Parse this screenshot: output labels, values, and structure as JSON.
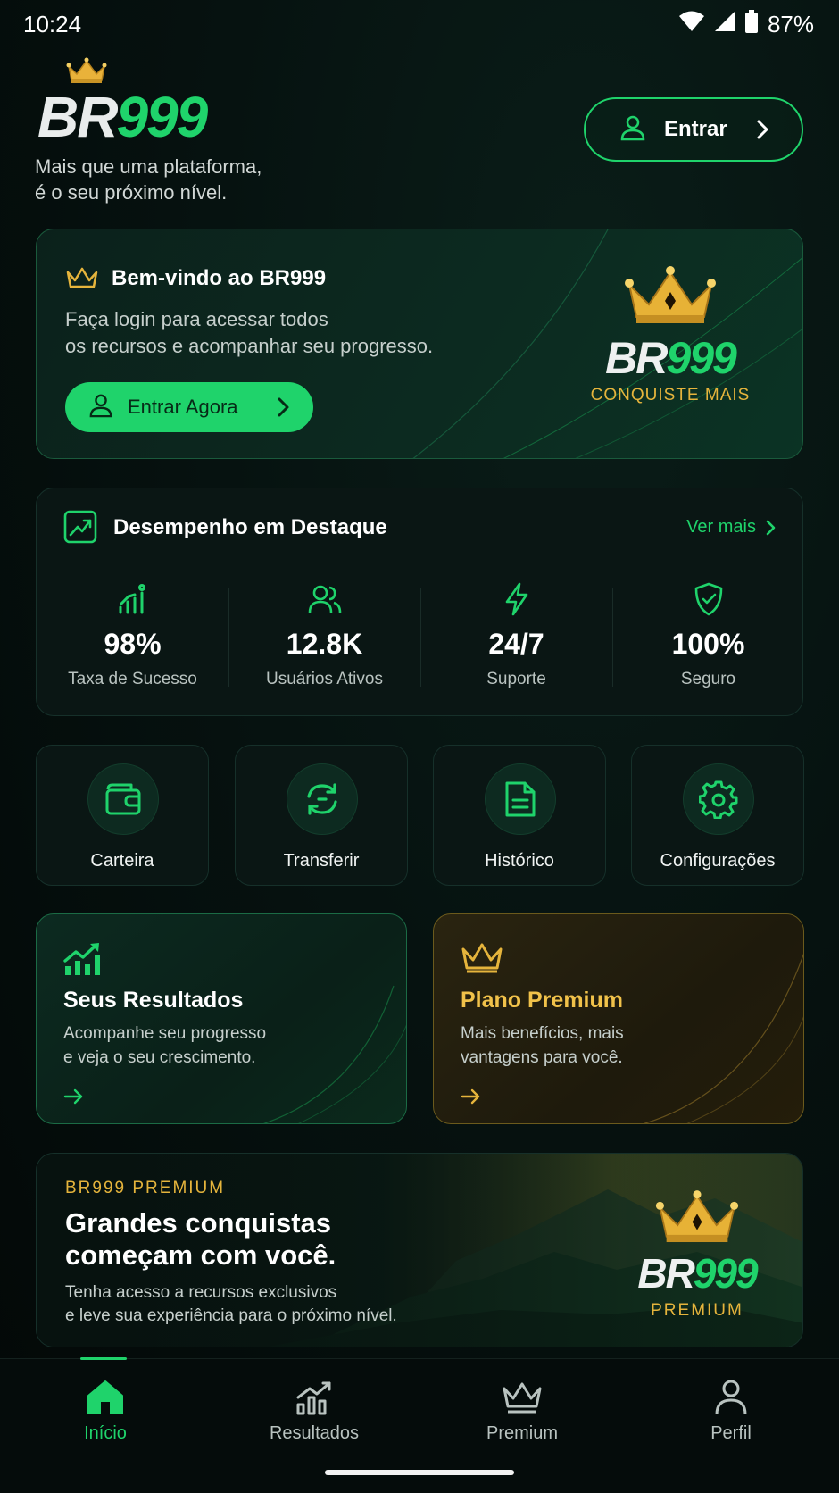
{
  "status": {
    "time": "10:24",
    "battery": "87%"
  },
  "header": {
    "logo_br": "BR",
    "logo_num": "999",
    "tagline_line1": "Mais que uma plataforma,",
    "tagline_line2": "é o seu próximo nível.",
    "login_label": "Entrar"
  },
  "welcome": {
    "title": "Bem-vindo ao BR999",
    "desc_line1": "Faça login para acessar todos",
    "desc_line2": "os recursos e acompanhar seu progresso.",
    "cta_label": "Entrar Agora",
    "brand_br": "BR",
    "brand_num": "999",
    "brand_sub": "CONQUISTE MAIS"
  },
  "performance": {
    "title": "Desempenho em Destaque",
    "more_label": "Ver mais",
    "stats": [
      {
        "icon": "signal-bars-icon",
        "value": "98%",
        "label": "Taxa de Sucesso"
      },
      {
        "icon": "users-icon",
        "value": "12.8K",
        "label": "Usuários Ativos"
      },
      {
        "icon": "lightning-icon",
        "value": "24/7",
        "label": "Suporte"
      },
      {
        "icon": "shield-check-icon",
        "value": "100%",
        "label": "Seguro"
      }
    ]
  },
  "quick_actions": [
    {
      "icon": "wallet-icon",
      "label": "Carteira"
    },
    {
      "icon": "transfer-icon",
      "label": "Transferir"
    },
    {
      "icon": "document-icon",
      "label": "Histórico"
    },
    {
      "icon": "gear-icon",
      "label": "Configurações"
    }
  ],
  "features": [
    {
      "icon": "trend-up-icon",
      "title": "Seus Resultados",
      "desc_line1": "Acompanhe seu progresso",
      "desc_line2": "e veja o seu crescimento."
    },
    {
      "icon": "crown-icon",
      "title": "Plano Premium",
      "desc_line1": "Mais benefícios, mais",
      "desc_line2": "vantagens para você."
    }
  ],
  "banner": {
    "kicker": "BR999 PREMIUM",
    "title_line1": "Grandes conquistas",
    "title_line2": "começam com você.",
    "desc_line1": "Tenha acesso a recursos exclusivos",
    "desc_line2": "e leve sua experiência para o próximo nível.",
    "logo_br": "BR",
    "logo_num": "999",
    "logo_sub": "PREMIUM"
  },
  "nav": [
    {
      "icon": "home-icon",
      "label": "Início",
      "active": true
    },
    {
      "icon": "chart-icon",
      "label": "Resultados",
      "active": false
    },
    {
      "icon": "crown-icon",
      "label": "Premium",
      "active": false
    },
    {
      "icon": "person-icon",
      "label": "Perfil",
      "active": false
    }
  ],
  "colors": {
    "accent": "#1fd36b",
    "gold": "#e5b43c",
    "background": "#040c0a"
  }
}
